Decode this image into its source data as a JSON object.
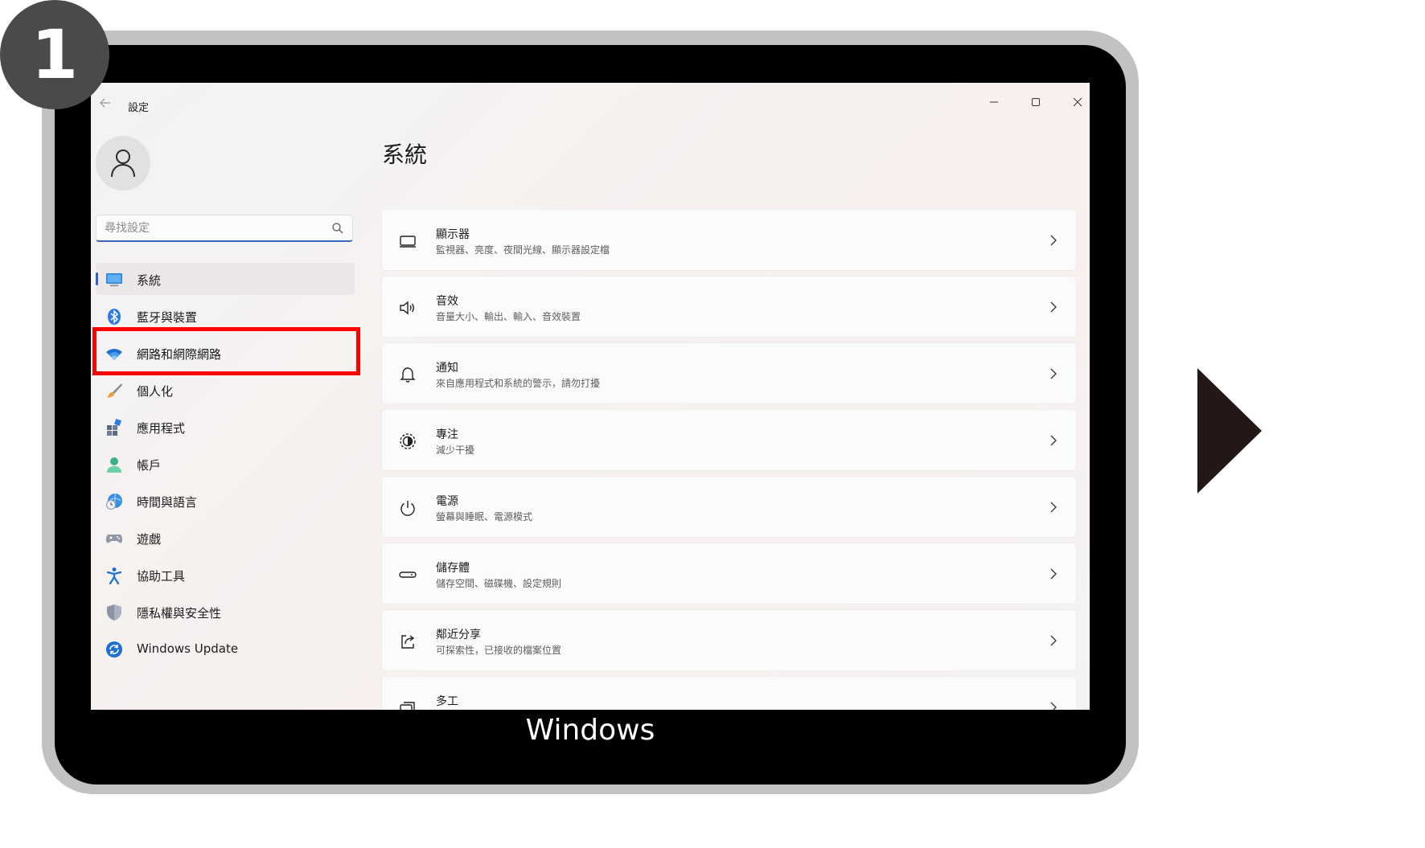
{
  "step_badge": "1",
  "device_label": "Windows",
  "window": {
    "title": "設定",
    "controls": {
      "minimize_icon": "minimize-icon",
      "maximize_icon": "maximize-icon",
      "close_icon": "close-icon"
    }
  },
  "search": {
    "placeholder": "尋找設定",
    "value": ""
  },
  "sidebar": {
    "items": [
      {
        "label": "系統",
        "icon": "system-icon",
        "active": true
      },
      {
        "label": "藍牙與裝置",
        "icon": "bluetooth-icon"
      },
      {
        "label": "網路和網際網路",
        "icon": "wifi-icon",
        "highlighted": true
      },
      {
        "label": "個人化",
        "icon": "brush-icon"
      },
      {
        "label": "應用程式",
        "icon": "apps-icon"
      },
      {
        "label": "帳戶",
        "icon": "account-icon"
      },
      {
        "label": "時間與語言",
        "icon": "time-language-icon"
      },
      {
        "label": "遊戲",
        "icon": "gamepad-icon"
      },
      {
        "label": "協助工具",
        "icon": "accessibility-icon"
      },
      {
        "label": "隱私權與安全性",
        "icon": "shield-icon"
      },
      {
        "label": "Windows Update",
        "icon": "update-icon"
      }
    ]
  },
  "main": {
    "title": "系統",
    "items": [
      {
        "title": "顯示器",
        "subtitle": "監視器、亮度、夜間光線、顯示器設定檔",
        "icon": "display-icon"
      },
      {
        "title": "音效",
        "subtitle": "音量大小、輸出、輸入、音效裝置",
        "icon": "sound-icon"
      },
      {
        "title": "通知",
        "subtitle": "來自應用程式和系統的警示，請勿打擾",
        "icon": "bell-icon"
      },
      {
        "title": "專注",
        "subtitle": "減少干擾",
        "icon": "focus-icon"
      },
      {
        "title": "電源",
        "subtitle": "螢幕與睡眠、電源模式",
        "icon": "power-icon"
      },
      {
        "title": "儲存體",
        "subtitle": "儲存空間、磁碟機、設定規則",
        "icon": "storage-icon"
      },
      {
        "title": "鄰近分享",
        "subtitle": "可探索性，已接收的檔案位置",
        "icon": "share-icon"
      },
      {
        "title": "多工",
        "subtitle": "",
        "icon": "multitask-icon"
      }
    ]
  },
  "colors": {
    "accent": "#2b5fcf",
    "highlight": "#ff0000",
    "badge": "#4a4a4a",
    "arrow": "#231815"
  }
}
